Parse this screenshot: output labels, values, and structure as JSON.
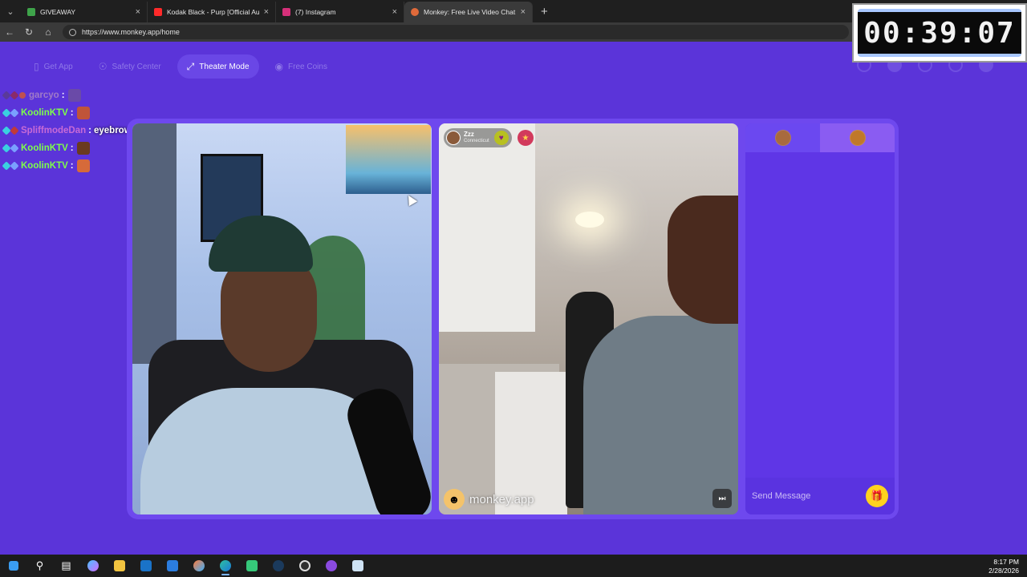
{
  "browser": {
    "tabs": [
      {
        "title": "GIVEAWAY",
        "fav_color": "#3ea34a"
      },
      {
        "title": "Kodak Black - Purp [Official Audio]",
        "fav_color": "#ff2a2a"
      },
      {
        "title": "(7) Instagram",
        "fav_color": "#d6307a"
      },
      {
        "title": "Monkey: Free Live Video Chat",
        "fav_color": "#e06a3a"
      }
    ],
    "url": "https://www.monkey.app/home"
  },
  "site": {
    "nav": [
      {
        "label": "Get App",
        "icon": "phone-icon"
      },
      {
        "label": "Safety Center",
        "icon": "shield-icon"
      },
      {
        "label": "Theater Mode",
        "icon": "expand-icon"
      },
      {
        "label": "Free Coins",
        "icon": "coins-icon"
      }
    ]
  },
  "chat_overlay": [
    {
      "user": "garcyo",
      "color": "#a07ac8",
      "message": "",
      "emote_color": "#6a4aa8"
    },
    {
      "user": "KoolinKTV",
      "color": "#7dff4a",
      "message": "",
      "emote_color": "#c0543a"
    },
    {
      "user": "SpliffmodeDan",
      "color": "#c86ad6",
      "message": "eyebrows was crazy",
      "emote_color": ""
    },
    {
      "user": "KoolinKTV",
      "color": "#7dff4a",
      "message": "",
      "emote_color": "#6a3a20"
    },
    {
      "user": "KoolinKTV",
      "color": "#7dff4a",
      "message": "",
      "emote_color": "#d66a3a"
    }
  ],
  "remote_user": {
    "name": "Zzz",
    "location": "Connecticut"
  },
  "video_brand": "monkey.app",
  "chat_panel": {
    "placeholder": "Send Message"
  },
  "timer": "00:39:07",
  "taskbar": {
    "time": "8:17 PM",
    "date": "2/28/2026"
  },
  "colors": {
    "page_bg": "#5b34d9",
    "stage_bg": "#6e48ee",
    "accent": "#ffd21f"
  }
}
